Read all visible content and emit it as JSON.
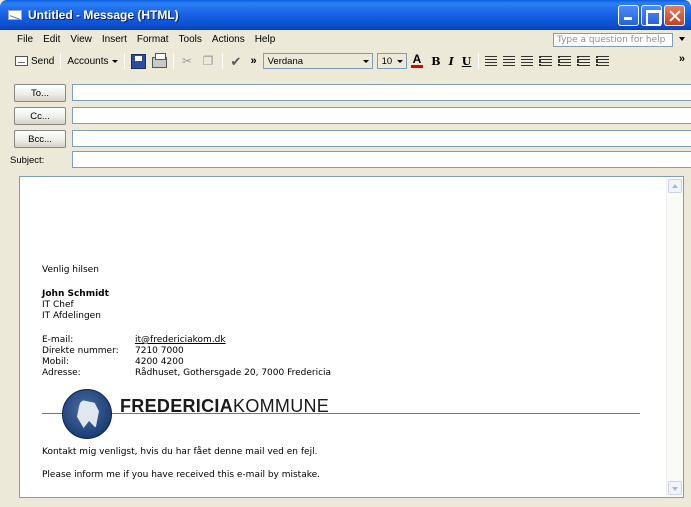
{
  "window": {
    "title": "Untitled - Message (HTML)"
  },
  "menu": {
    "items": [
      "File",
      "Edit",
      "View",
      "Insert",
      "Format",
      "Tools",
      "Actions",
      "Help"
    ],
    "help_placeholder": "Type a question for help"
  },
  "toolbar": {
    "send_label": "Send",
    "accounts_label": "Accounts",
    "font_name": "Verdana",
    "font_size": "10",
    "bold": "B",
    "italic": "I",
    "underline": "U"
  },
  "header": {
    "to_label": "To...",
    "cc_label": "Cc...",
    "bcc_label": "Bcc...",
    "subject_label": "Subject:",
    "to_value": "",
    "cc_value": "",
    "bcc_value": "",
    "subject_value": ""
  },
  "signature": {
    "greeting": "Venlig hilsen",
    "name": "John Schmidt",
    "role": "IT Chef",
    "department": "IT Afdelingen",
    "contacts": [
      {
        "label": "E-mail:",
        "value": "it@fredericiakom.dk"
      },
      {
        "label": "Direkte nummer:",
        "value": "7210 7000"
      },
      {
        "label": "Mobil:",
        "value": "4200 4200"
      },
      {
        "label": "Adresse:",
        "value": "Rådhuset, Gothersgade 20, 7000 Fredericia"
      }
    ],
    "brand_bold": "FREDERICIA",
    "brand_light": "KOMMUNE",
    "disclaimer_da": "Kontakt mig venligst, hvis du har fået denne mail ved en fejl.",
    "disclaimer_en": "Please inform me if you have received this e-mail by mistake."
  },
  "colors": {
    "titlebar": "#0b4fd0",
    "link": "#1f44c8",
    "chrome": "#ece9d8"
  }
}
